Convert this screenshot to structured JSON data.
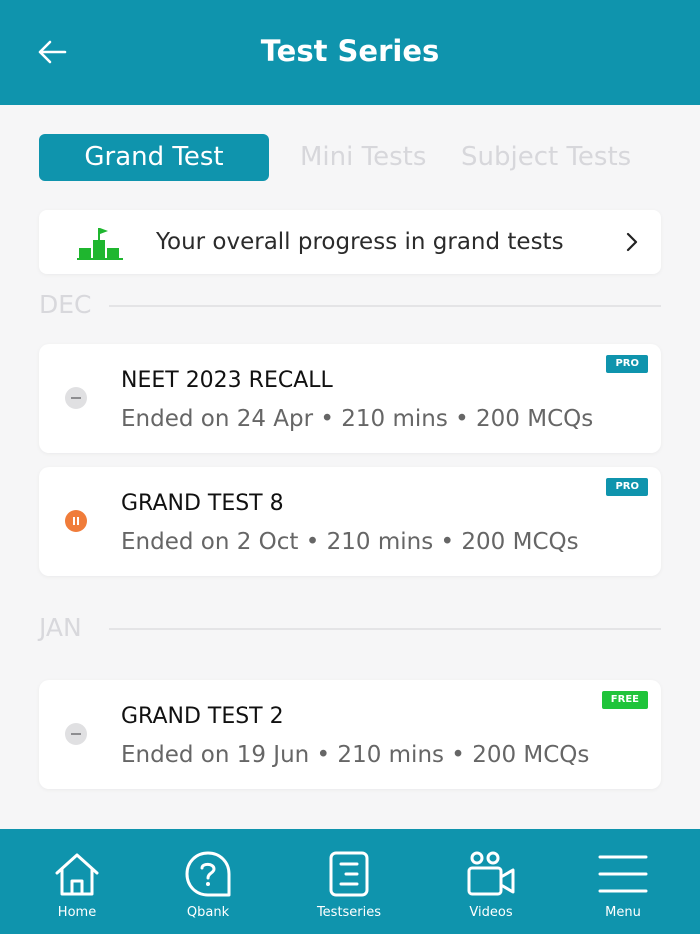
{
  "header": {
    "title": "Test Series",
    "back_icon": "arrow-left-icon"
  },
  "tabs": [
    {
      "label": "Grand Test",
      "active": true
    },
    {
      "label": "Mini Tests",
      "active": false
    },
    {
      "label": "Subject Tests",
      "active": false
    }
  ],
  "progress": {
    "text": "Your overall progress in grand tests",
    "icon": "podium-flag-icon",
    "chevron_icon": "chevron-right-icon"
  },
  "months": [
    {
      "label": "DEC",
      "tests": [
        {
          "name": "NEET 2023 RECALL",
          "meta": "Ended on 24 Apr • 210 mins • 200 MCQs",
          "badge": "PRO",
          "status": "ended"
        },
        {
          "name": "GRAND TEST 8",
          "meta": "Ended on 2 Oct • 210 mins • 200 MCQs",
          "badge": "PRO",
          "status": "paused"
        }
      ]
    },
    {
      "label": "JAN",
      "tests": [
        {
          "name": "GRAND TEST 2",
          "meta": "Ended on 19 Jun • 210 mins • 200 MCQs",
          "badge": "FREE",
          "status": "ended"
        }
      ]
    }
  ],
  "bottom_nav": [
    {
      "label": "Home",
      "icon": "home-icon"
    },
    {
      "label": "Qbank",
      "icon": "question-bubble-icon"
    },
    {
      "label": "Testseries",
      "icon": "test-list-icon"
    },
    {
      "label": "Videos",
      "icon": "video-camera-icon"
    },
    {
      "label": "Menu",
      "icon": "hamburger-menu-icon"
    }
  ],
  "colors": {
    "primary": "#0f94ad",
    "badge_pro": "#0f94ad",
    "badge_free": "#1fc43a",
    "status_paused": "#f07c3a",
    "progress_icon": "#1fb62f"
  }
}
